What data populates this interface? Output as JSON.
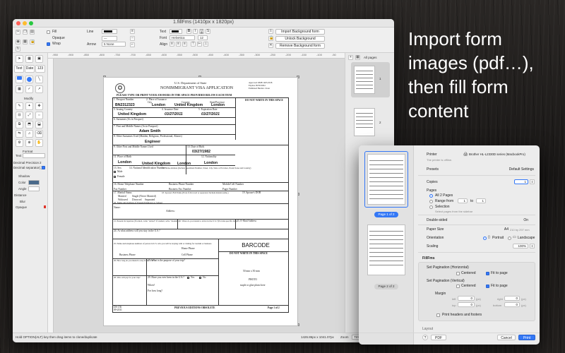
{
  "window": {
    "title": "1.fillFms (1410px x 1820px)"
  },
  "toolbar": {
    "fill_label": "Fill",
    "opaque_label": "Opaque",
    "wrap_label": "Wrap",
    "line_label": "Line",
    "arrow_label": "Arrow",
    "arrow_value": "5  None",
    "text_label": "Text",
    "font_label": "Font",
    "font_value": "Helvetica",
    "size_value": "12",
    "align_label": "Align",
    "import_bg": "Import Background form",
    "unlock_bg": "Unlock Background",
    "remove_bg": "Remove Background form"
  },
  "palette": {
    "text_btn": "Text",
    "date_btn": "Date",
    "num_btn": "123",
    "modify_label": "Modify",
    "format_label": "Format",
    "text_field": "Text",
    "decimal_precision": "Decimal Precision",
    "decimal_precision_value": "2",
    "decimal_separator": "Decimal separator(.)",
    "shadow_label": "Shadow",
    "color_label": "Color",
    "angle_label": "Angle",
    "distance_label": "Distance",
    "blur_label": "Blur",
    "opaque_label": "Opaque",
    "color_hex": "#4a6a8a"
  },
  "ruler": {
    "marks": [
      "-950",
      "-900",
      "-850",
      "-800",
      "-750",
      "-700",
      "-650",
      "-600",
      "-550",
      "-500",
      "-450",
      "-400",
      "-350",
      "-300",
      "-250",
      "-200",
      "-150",
      "-100",
      "-50"
    ]
  },
  "form": {
    "dept": "U.S. Department of State",
    "title": "NONIMMIGRANT VISA APPLICATION",
    "instructions": "PLEASE TYPE OR PRINT YOUR ANSWERS IN THE SPACE PROVIDED BELOW EACH ITEM",
    "approved": "Approved OMB 1405-0018",
    "expires": "Expires 09/30/2004",
    "estimated": "Estimated Burden 1 hour",
    "do_not_write": "DO NOT WRITE IN THIS SPACE",
    "passport_no_lbl": "1. Passport Number",
    "place_issuance_lbl": "2. Place of Issuance:",
    "city_lbl": "City",
    "country_lbl": "Country",
    "state_province_lbl": "State/Province",
    "passport_no": "BN2312323",
    "issue_city": "London",
    "issue_country": "United Kingdom",
    "issue_state": "London",
    "issuing_country_lbl": "3. Issuing Country",
    "issuance_date_lbl": "4. Issuance Date",
    "expiration_date_lbl": "5. Expiration Date",
    "date_format": "(dd-mmm-yyyy)",
    "issuing_country": "United Kingdom",
    "issuance_date": "03/27/2011",
    "expiration_date": "03/27/2021",
    "surnames_lbl": "6. Surnames (As in Passport)",
    "first_middle_lbl": "7. First and Middle Names (As in Passport)",
    "first_middle": "Adam Smith",
    "other_surnames_lbl": "8. Other Surnames Used (Maiden, Religious, Professional, Aliases)",
    "other_surnames": "Engineer",
    "other_first_lbl": "9. Other First and Middle Names Used",
    "dob_lbl": "10. Date of Birth",
    "dob": "03/27/1982",
    "pob_lbl": "11. Place of Birth",
    "nationality_lbl": "12. Nationality",
    "pob_city": "London",
    "pob_country": "United Kingdom",
    "pob_state": "London",
    "nationality": "London",
    "sex_lbl": "13. Sex",
    "male_lbl": "Male",
    "female_lbl": "Female",
    "national_id_lbl": "14. National Identification Number",
    "national_id_note": "(If applicable)",
    "home_address_lbl": "15. Home Address (Include Apartment Number, Street, City, State or Province, Postal Zone and Country)",
    "home_phone_lbl": "16. Home Telephone Number",
    "business_phone_lbl": "Business Phone Number",
    "mobile_lbl": "Mobile/Cell Number",
    "fax_lbl": "Fax Number",
    "business_fax_lbl": "Business Fax Number",
    "pager_lbl": "Pager Number",
    "marital_lbl": "17. Marital Status",
    "married": "Married",
    "single": "Single (Never Married)",
    "widowed": "Widowed",
    "divorced": "Divorced",
    "separated": "Separated",
    "spouse_lbl": "18. Spouse's Full Name (Even if divorced or separated. Include maiden name.)",
    "spouse_dob_lbl": "19. Spouse's DOB",
    "employer_lbl": "20. Name and Address of Present Employer or School",
    "name_lbl": "Name:",
    "address_lbl": "Address:",
    "occupation_lbl": "21. Present Occupation (If retired, write \"retired\". If student, write \"student\".)",
    "arrive_lbl": "22. When do you intend to arrive in the U.S.? (Provide specific date)",
    "email_lbl": "23. E-Mail Address",
    "stay_lbl": "24. At what address will you stay in the U.S.?",
    "barcode": "BARCODE",
    "contact_lbl": "25. Name and telephone numbers of person in U.S. who you will be staying with or visiting for tourism or business",
    "home_phone2": "Home Phone",
    "business_phone2": "Business Phone",
    "cell_phone2": "Cell Phone",
    "how_long_lbl": "26. How long do you intend to stay in the U.S.?",
    "purpose_lbl": "27. What is the purpose of your trip?",
    "photo_size": "50 mm x 50 mm",
    "photo": "PHOTO",
    "photo_staple": "staple or glue photo here",
    "pay_lbl": "28. Who will pay for your trip?",
    "been_lbl": "29. Have you ever been in the U.S.?",
    "yes_lbl": "Yes",
    "no_lbl": "No",
    "when_lbl": "When?",
    "how_long2_lbl": "For how long?",
    "ds156": "DS-156",
    "date_rev": "09-2011",
    "prev_editions": "PREVIOUS EDITIONS OBSOLETE",
    "page_of": "Page 1 of 2"
  },
  "thumbs": {
    "header": "All pages",
    "page1": "1",
    "page2": "2"
  },
  "status": {
    "hint": "Hold OPTION(ALT) key then drag items to clone/duplicate",
    "size": "1426.86px x 1041.07px",
    "zoom_label": "Zoom",
    "zoom_value": "75%"
  },
  "print": {
    "printer_lbl": "Printer",
    "printer_value": "Brother HL-L2330D series (MacbookPro)",
    "printer_offline": "The printer is offline.",
    "presets_lbl": "Presets",
    "presets_value": "Default Settings",
    "copies_lbl": "Copies",
    "copies_value": "1",
    "pages_lbl": "Pages",
    "all_pages": "All 2 Pages",
    "range_from": "Range from",
    "range_from_val": "1",
    "range_to": "to",
    "range_to_val": "1",
    "selection": "Selection",
    "selection_note": "Select pages from the sidebar",
    "double_sided_lbl": "Double-sided",
    "double_sided_val": "On",
    "paper_size_lbl": "Paper Size",
    "paper_size_val": "A4",
    "paper_size_dim": "210 by 297 mm",
    "orientation_lbl": "Orientation",
    "portrait": "Portrait",
    "landscape": "Landscape",
    "scaling_lbl": "Scaling",
    "scaling_val": "100%",
    "fillfms_lbl": "FillFms",
    "set_pag_h": "Set Pagination (Horizontal)",
    "centered": "Centered",
    "fit_page": "Fit to page",
    "set_pag_v": "Set Pagination (Vertical)",
    "margin_lbl": "Margin",
    "left_lbl": "left",
    "top_lbl": "top",
    "right_lbl": "right",
    "bottom_lbl": "bottom",
    "margin_zero": "0",
    "px": "(px)",
    "print_headers": "Print headers and footers",
    "layout_lbl": "Layout",
    "page1_pill": "Page 1 of 2",
    "page2_pill": "Page 2 of 2",
    "pdf_btn": "PDF",
    "cancel_btn": "Cancel",
    "print_btn": "Print",
    "help_btn": "?"
  },
  "headline": {
    "text": "Import form images (pdf…), then fill form content"
  }
}
